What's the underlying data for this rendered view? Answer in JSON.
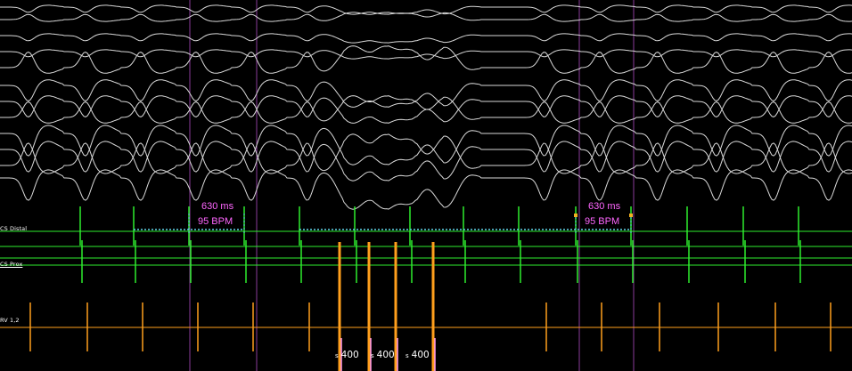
{
  "channels": [
    {
      "id": "cs_distal",
      "label": "CS Distal",
      "color": "#2eee2e"
    },
    {
      "id": "cs_prox",
      "label": "CS Prox",
      "color": "#2eee2e"
    },
    {
      "id": "rv",
      "label": "RV 1,2",
      "color": "#ff9f1c"
    }
  ],
  "surface_ecg_color": "#d8d8d8",
  "sync_marker_color": "#8a3c9a",
  "caliper_color": "#5fd3e6",
  "calipers": [
    {
      "interval": "630 ms",
      "rate": "95 BPM"
    },
    {
      "interval": "630 ms",
      "rate": "95 BPM"
    }
  ],
  "pacing": {
    "marker": "s",
    "intervals": [
      "400",
      "400",
      "400"
    ],
    "color": "#ff9f1c"
  }
}
